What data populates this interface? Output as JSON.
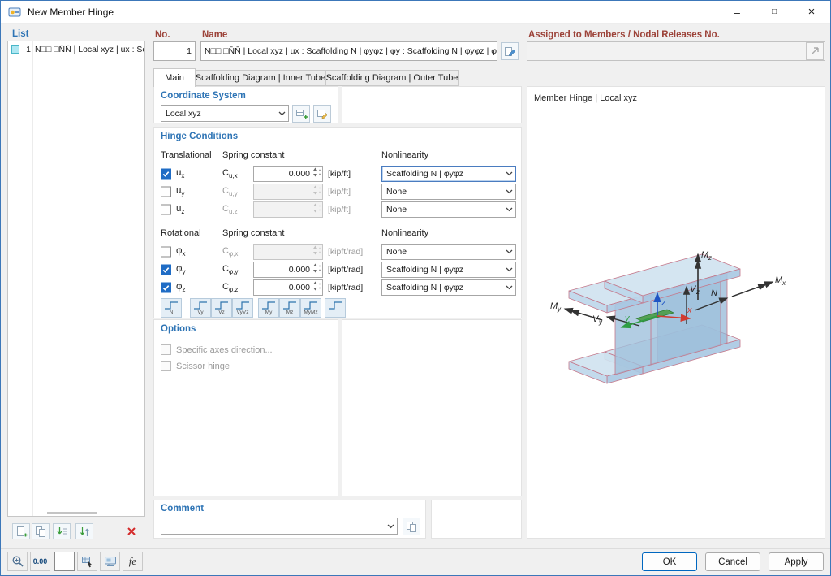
{
  "window": {
    "title": "New Member Hinge",
    "controls": {
      "minimize": "–",
      "maximize": "□",
      "close": "×"
    }
  },
  "list_panel": {
    "title": "List",
    "item": {
      "number": "1",
      "label": "N□□ □N̄N̄ | Local xyz | ux : Sca"
    }
  },
  "header": {
    "no_label": "No.",
    "no_value": "1",
    "name_label": "Name",
    "name_value": "N□□ □N̄N̄ | Local xyz | ux : Scaffolding N | φyφz | φy : Scaffolding N | φyφz | φz :",
    "assigned_label": "Assigned to Members / Nodal Releases No.",
    "assigned_value": ""
  },
  "tabs": {
    "main": "Main",
    "inner": "Scaffolding Diagram | Inner Tube",
    "outer": "Scaffolding Diagram | Outer Tube"
  },
  "coordinate_system": {
    "title": "Coordinate System",
    "value": "Local xyz"
  },
  "hinge": {
    "title": "Hinge Conditions",
    "col_translational": "Translational",
    "col_rotational": "Rotational",
    "col_spring": "Spring constant",
    "col_nonlinearity": "Nonlinearity",
    "rows": [
      {
        "sym": "u",
        "sub": "x",
        "c": "C",
        "csub": "u,x",
        "value": "0.000",
        "unit": "[kip/ft]",
        "nl": "Scaffolding N | φyφz",
        "checked": true,
        "enabled": true
      },
      {
        "sym": "u",
        "sub": "y",
        "c": "C",
        "csub": "u,y",
        "value": "",
        "unit": "[kip/ft]",
        "nl": "None",
        "checked": false,
        "enabled": false
      },
      {
        "sym": "u",
        "sub": "z",
        "c": "C",
        "csub": "u,z",
        "value": "",
        "unit": "[kip/ft]",
        "nl": "None",
        "checked": false,
        "enabled": false
      },
      {
        "sym": "φ",
        "sub": "x",
        "c": "C",
        "csub": "φ,x",
        "value": "",
        "unit": "[kipft/rad]",
        "nl": "None",
        "checked": false,
        "enabled": false
      },
      {
        "sym": "φ",
        "sub": "y",
        "c": "C",
        "csub": "φ,y",
        "value": "0.000",
        "unit": "[kipft/rad]",
        "nl": "Scaffolding N | φyφz",
        "checked": true,
        "enabled": true
      },
      {
        "sym": "φ",
        "sub": "z",
        "c": "C",
        "csub": "φ,z",
        "value": "0.000",
        "unit": "[kipft/rad]",
        "nl": "Scaffolding N | φyφz",
        "checked": true,
        "enabled": true
      }
    ],
    "presets": [
      {
        "label": "N"
      },
      {
        "label": "Vy"
      },
      {
        "label": "Vz"
      },
      {
        "label": "VyVz"
      },
      {
        "label": "My"
      },
      {
        "label": "Mz"
      },
      {
        "label": "MyMz"
      },
      {
        "label": ""
      }
    ]
  },
  "options": {
    "title": "Options",
    "cb_axes": "Specific axes direction...",
    "cb_scissor": "Scissor hinge"
  },
  "comment": {
    "title": "Comment",
    "value": ""
  },
  "preview": {
    "title": "Member Hinge | Local xyz",
    "labels": {
      "mz": {
        "m": "M",
        "s": "z"
      },
      "vz": {
        "m": "V",
        "s": "z"
      },
      "mx": {
        "m": "M",
        "s": "x"
      },
      "n": {
        "m": "N",
        "s": ""
      },
      "my": {
        "m": "M",
        "s": "y"
      },
      "vy": {
        "m": "V",
        "s": "y"
      },
      "x": "x",
      "y": "y",
      "z": "z"
    }
  },
  "footer": {
    "units": "0.00",
    "fe": "fe",
    "ok": "OK",
    "cancel": "Cancel",
    "apply": "Apply"
  }
}
